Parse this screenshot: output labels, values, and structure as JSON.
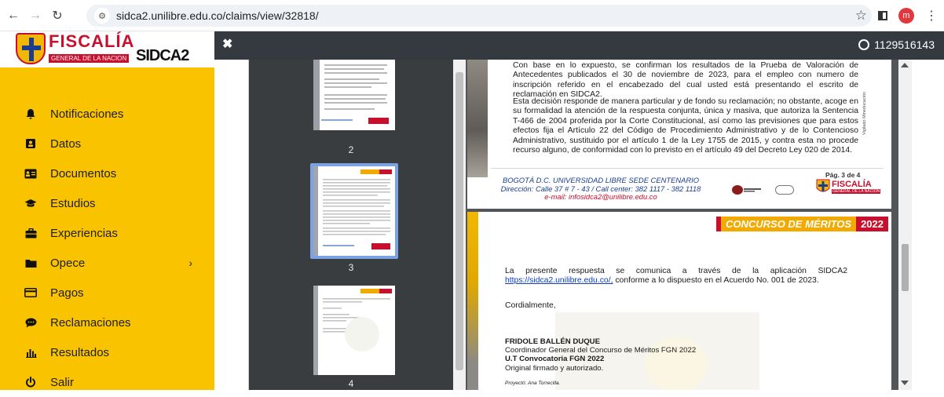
{
  "browser": {
    "url": "sidca2.unilibre.edu.co/claims/view/32818/",
    "profile_initial": "m"
  },
  "sidebar": {
    "logo_title": "FISCALÍA",
    "logo_subtitle": "GENERAL DE LA NACION",
    "logo_app": "SIDCA2",
    "items": [
      {
        "label": "Notificaciones",
        "icon": "bell-icon"
      },
      {
        "label": "Datos",
        "icon": "id-card-icon"
      },
      {
        "label": "Documentos",
        "icon": "address-card-icon"
      },
      {
        "label": "Estudios",
        "icon": "graduation-cap-icon"
      },
      {
        "label": "Experiencias",
        "icon": "briefcase-icon"
      },
      {
        "label": "Opece",
        "icon": "folder-icon"
      },
      {
        "label": "Pagos",
        "icon": "credit-card-icon"
      },
      {
        "label": "Reclamaciones",
        "icon": "comment-icon"
      },
      {
        "label": "Resultados",
        "icon": "bar-chart-icon"
      },
      {
        "label": "Salir",
        "icon": "power-icon"
      }
    ]
  },
  "topbar": {
    "user_id": "1129516143"
  },
  "thumbnails": [
    {
      "page": "2"
    },
    {
      "page": "3"
    },
    {
      "page": "4"
    }
  ],
  "document": {
    "page3": {
      "paragraph1": "Con base en lo expuesto, se confirman los resultados de la Prueba de Valoración de Antecedentes publicados el 30 de noviembre de 2023, para el empleo con numero de inscripción referido en el encabezado del cual usted está presentando el escrito de reclamación en SIDCA2.",
      "paragraph2": "Esta decisión responde de manera particular y de fondo su reclamación; no obstante, acoge en su formalidad la atención de la respuesta conjunta, única y masiva, que autoriza la Sentencia T-466 de 2004 proferida por la Corte Constitucional, así como las previsiones que para estos efectos fija el Artículo 22 del Código de Procedimiento Administrativo y de lo Contencioso Administrativo, sustituido por el artículo 1 de la Ley 1755 de 2015, y contra esta no procede recurso alguno, de conformidad con lo previsto en el artículo 49 del Decreto Ley 020 de 2014.",
      "footer_line1": "BOGOTÁ D.C. UNIVERSIDAD LIBRE SEDE CENTENARIO",
      "footer_line2": "Dirección: Calle 37 # 7 - 43 / Call center: 382 1117 - 382 1118",
      "footer_line3": "e-mail: infosidca2@unilibre.edu.co",
      "page_label": "Pág. 3 de 4",
      "side_note": "Vigilado Mineducación"
    },
    "page4": {
      "banner_label": "CONCURSO DE MÉRITOS",
      "banner_year": "2022",
      "text_before_link": "La presente respuesta se comunica a través de la aplicación SIDCA2",
      "link": "https://sidca2.unilibre.edu.co/,",
      "text_after_link": "conforme a lo dispuesto en el Acuerdo No. 001 de 2023.",
      "closing": "Cordialmente,",
      "signer_name": "FRIDOLE BALLÉN DUQUE",
      "signer_role": "Coordinador General del Concurso de Méritos FGN 2022",
      "signer_org": "U.T Convocatoria FGN 2022",
      "signer_note": "Original firmado y autorizado.",
      "projected_by": "Proyectó: Ana Torrecilla."
    }
  },
  "colors": {
    "sidebar_bg": "#f9c300",
    "topbar_bg": "#343a40",
    "brand_red": "#c8102e"
  }
}
